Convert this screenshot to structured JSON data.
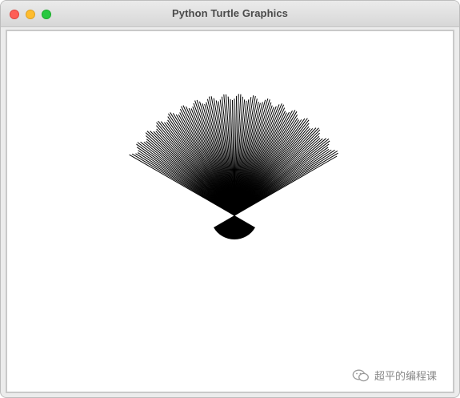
{
  "window": {
    "title": "Python Turtle Graphics"
  },
  "colors": {
    "close": "#fe5f57",
    "minimize": "#febc2e",
    "maximize": "#28c840",
    "pen": "#000000",
    "background": "#ffffff"
  },
  "drawing": {
    "shape": "fan",
    "pen_color": "black",
    "upper_arc_start_deg": 30,
    "upper_arc_end_deg": 150,
    "lower_arc_start_deg": 210,
    "lower_arc_end_deg": 330,
    "line_count": 120
  },
  "watermark": {
    "text": "超平的编程课",
    "icon": "wechat-icon"
  }
}
